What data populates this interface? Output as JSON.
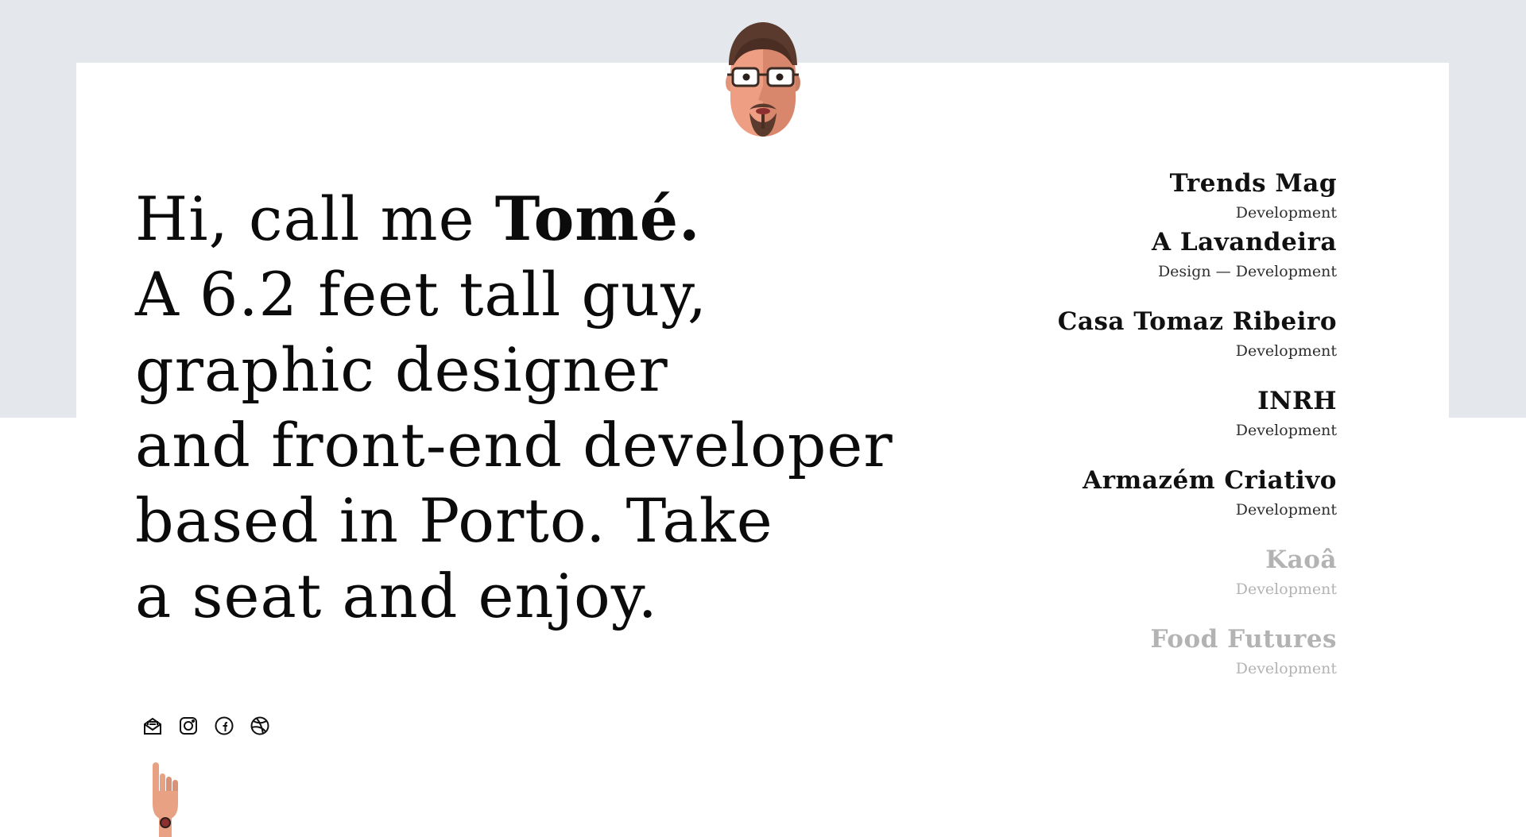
{
  "intro": {
    "greeting": "Hi, call me ",
    "name": "Tomé.",
    "line2": "A 6.2 feet tall guy,",
    "line3": "graphic designer",
    "line4": "and front-end developer",
    "line5": "based in Porto. Take",
    "line6": "a seat and enjoy."
  },
  "projects": [
    {
      "title": "Trends Mag",
      "meta": "Development",
      "muted": false
    },
    {
      "title": "A Lavandeira",
      "meta": "Design — Development",
      "muted": false
    },
    {
      "title": "Casa Tomaz Ribeiro",
      "meta": "Development",
      "muted": false
    },
    {
      "title": "INRH",
      "meta": "Development",
      "muted": false
    },
    {
      "title": "Armazém Criativo",
      "meta": "Development",
      "muted": false
    },
    {
      "title": "Kaoâ",
      "meta": "Development",
      "muted": true
    },
    {
      "title": "Food Futures",
      "meta": "Development",
      "muted": true
    }
  ],
  "social": [
    "mail-icon",
    "instagram-icon",
    "facebook-icon",
    "dribbble-icon"
  ],
  "colors": {
    "band": "#e4e7eb",
    "text": "#0b0b0b",
    "muted": "#b3b3b3",
    "skin": "#e8a283"
  }
}
